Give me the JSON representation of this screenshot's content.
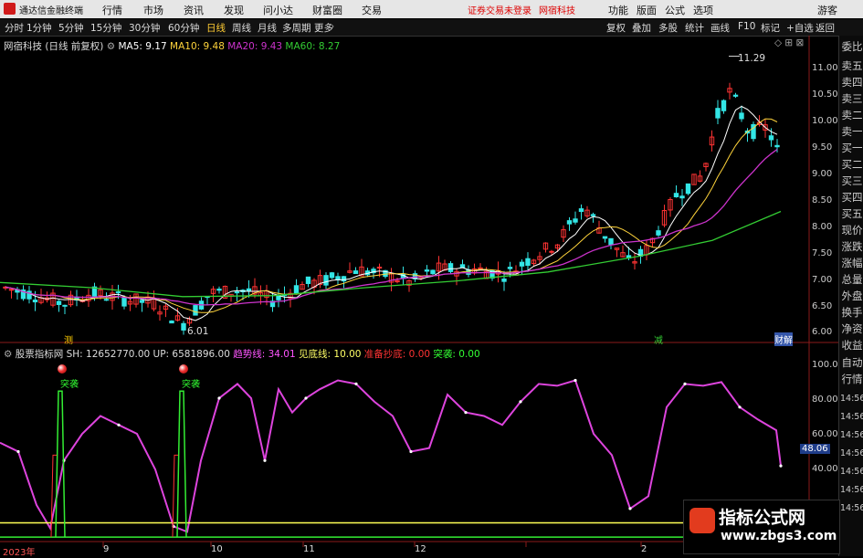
{
  "app": {
    "title": "通达信金融终端"
  },
  "menu": {
    "items": [
      "行情",
      "市场",
      "资讯",
      "发现",
      "问小达",
      "财富圈",
      "交易"
    ],
    "status1": "证券交易未登录",
    "status2": "网宿科技",
    "right": [
      "功能",
      "版面",
      "公式",
      "选项"
    ],
    "guest": "游客"
  },
  "periods": {
    "items": [
      "分时",
      "1分钟",
      "5分钟",
      "15分钟",
      "30分钟",
      "60分钟",
      "日线",
      "周线",
      "月线",
      "多周期",
      "更多"
    ],
    "active": "日线"
  },
  "toolbar": {
    "items": [
      "复权",
      "叠加",
      "多股",
      "统计",
      "画线",
      "F10",
      "标记",
      "+自选",
      "返回"
    ]
  },
  "main_chart": {
    "stock_name": "网宿科技",
    "chart_mode": "(日线 前复权)",
    "ma": [
      {
        "label": "MA5: 9.17",
        "color": "#ffffff"
      },
      {
        "label": "MA10: 9.48",
        "color": "#ffd43b"
      },
      {
        "label": "MA20: 9.43",
        "color": "#cc33cc"
      },
      {
        "label": "MA60: 8.27",
        "color": "#33cc33"
      }
    ],
    "high_label": "11.29",
    "low_label": "6.01",
    "marker_left": "测",
    "marker_mid": "减",
    "marker_right": "财解",
    "yaxis": [
      "11.00",
      "10.50",
      "10.00",
      "9.50",
      "9.00",
      "8.50",
      "8.00",
      "7.50",
      "7.00",
      "6.50",
      "6.00"
    ]
  },
  "indicator": {
    "name": "股票指标网",
    "fields": [
      {
        "label": "SH: 12652770.00",
        "color": "#dddddd"
      },
      {
        "label": "UP: 6581896.00",
        "color": "#dddddd"
      },
      {
        "label": "趋势线: 34.01",
        "color": "#ff55ff"
      },
      {
        "label": "见底线: 10.00",
        "color": "#ffff66"
      },
      {
        "label": "准备抄底: 0.00",
        "color": "#ff3333"
      },
      {
        "label": "突袭: 0.00",
        "color": "#33ff33"
      }
    ],
    "signal_label": "突袭",
    "yaxis": [
      "100.00",
      "80.00",
      "60.00",
      "40.00"
    ],
    "current": "48.06"
  },
  "xaxis": [
    "2023年",
    "9",
    "10",
    "11",
    "12",
    "2"
  ],
  "right_panel": [
    "委比",
    "卖五",
    "卖四",
    "卖三",
    "卖二",
    "卖一",
    "买一",
    "买二",
    "买三",
    "买四",
    "买五",
    "现价",
    "涨跌",
    "涨幅",
    "总量",
    "外盘",
    "换手",
    "净资",
    "收益",
    "自动",
    "行情",
    "14:56",
    "14:56",
    "14:56",
    "14:56",
    "14:56",
    "14:56",
    "14:56"
  ],
  "watermark": {
    "title": "指标公式网",
    "url": "www.zbgs3.com"
  },
  "colors": {
    "up": "#ff3333",
    "down": "#33e6e6",
    "ma5": "#ffffff",
    "ma10": "#ffd43b",
    "ma20": "#cc33cc",
    "ma60": "#33cc33",
    "trend": "#dd44dd",
    "bottom": "#ffff55",
    "signal": "#33ee33"
  }
}
